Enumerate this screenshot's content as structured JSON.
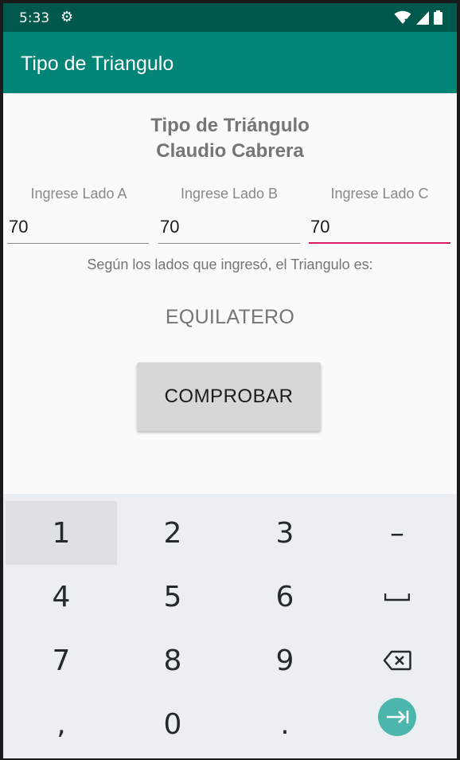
{
  "status_bar": {
    "time": "5:33",
    "settings_icon": "gear-icon",
    "wifi_icon": "wifi-icon",
    "signal_icon": "signal-icon",
    "battery_icon": "battery-icon"
  },
  "app_bar": {
    "title": "Tipo de Triangulo"
  },
  "heading": {
    "line1": "Tipo de Triángulo",
    "line2": "Claudio Cabrera"
  },
  "inputs": [
    {
      "label": "Ingrese Lado A",
      "value": "70"
    },
    {
      "label": "Ingrese Lado B",
      "value": "70"
    },
    {
      "label": "Ingrese Lado C",
      "value": "70"
    }
  ],
  "result_label": "Según los lados que ingresó, el Triangulo es:",
  "result_value": "EQUILATERO",
  "button_label": "COMPROBAR",
  "keyboard": {
    "keys": [
      "1",
      "2",
      "3",
      "–",
      "4",
      "5",
      "6",
      "",
      "7",
      "8",
      "9",
      "",
      ",",
      "0",
      ".",
      ""
    ],
    "special_icons": {
      "space": "space-icon",
      "backspace": "backspace-icon",
      "next": "next-arrow-icon"
    }
  },
  "colors": {
    "status_bar": "#00574b",
    "app_bar": "#008577",
    "accent": "#d81b60",
    "enter_key": "#4db6ac"
  }
}
